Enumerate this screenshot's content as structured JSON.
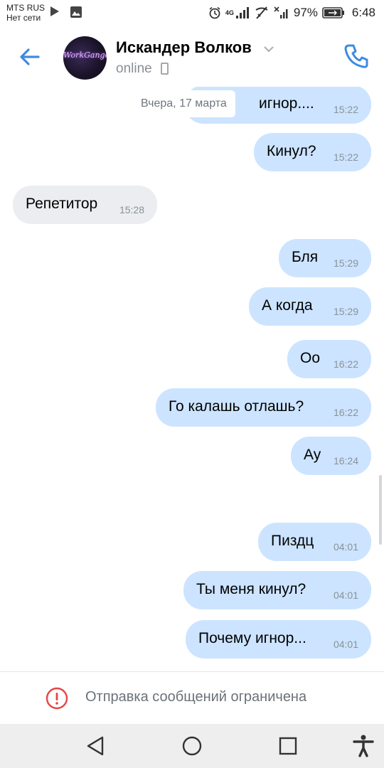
{
  "status_bar": {
    "carrier": "MTS RUS",
    "network": "Нет сети",
    "network_type": "4G",
    "battery": "97%",
    "time": "6:48"
  },
  "header": {
    "name": "Искандер Волков",
    "status": "online",
    "avatar_text": "WorkGange"
  },
  "date_separator": "Вчера, 17 марта",
  "messages": [
    {
      "dir": "out",
      "text": "игнор....",
      "time": "15:22"
    },
    {
      "dir": "out",
      "text": "Кинул?",
      "time": "15:22"
    },
    {
      "dir": "in",
      "text": "Репетитор",
      "time": "15:28"
    },
    {
      "dir": "out",
      "text": "Бля",
      "time": "15:29"
    },
    {
      "dir": "out",
      "text": "А когда",
      "time": "15:29"
    },
    {
      "dir": "out",
      "text": "Оо",
      "time": "16:22"
    },
    {
      "dir": "out",
      "text": "Го калашь отлашь?",
      "time": "16:22"
    },
    {
      "dir": "out",
      "text": "Ау",
      "time": "16:24"
    },
    {
      "dir": "out",
      "text": "Пиздц",
      "time": "04:01"
    },
    {
      "dir": "out",
      "text": "Ты меня кинул?",
      "time": "04:01"
    },
    {
      "dir": "out",
      "text": "Почему игнор...",
      "time": "04:01"
    }
  ],
  "footer": {
    "restriction_text": "Отправка сообщений ограничена"
  },
  "icons": {
    "back": "arrow-left-icon",
    "call": "phone-icon",
    "warning": "exclamation-circle-icon",
    "nav_back": "triangle-back-icon",
    "nav_home": "circle-home-icon",
    "nav_recent": "square-recent-icon",
    "accessibility": "accessibility-icon"
  },
  "colors": {
    "accent": "#3f8ae0",
    "outgoing_bubble": "#cce4ff",
    "incoming_bubble": "#ebedf0",
    "warning": "#e64646"
  }
}
